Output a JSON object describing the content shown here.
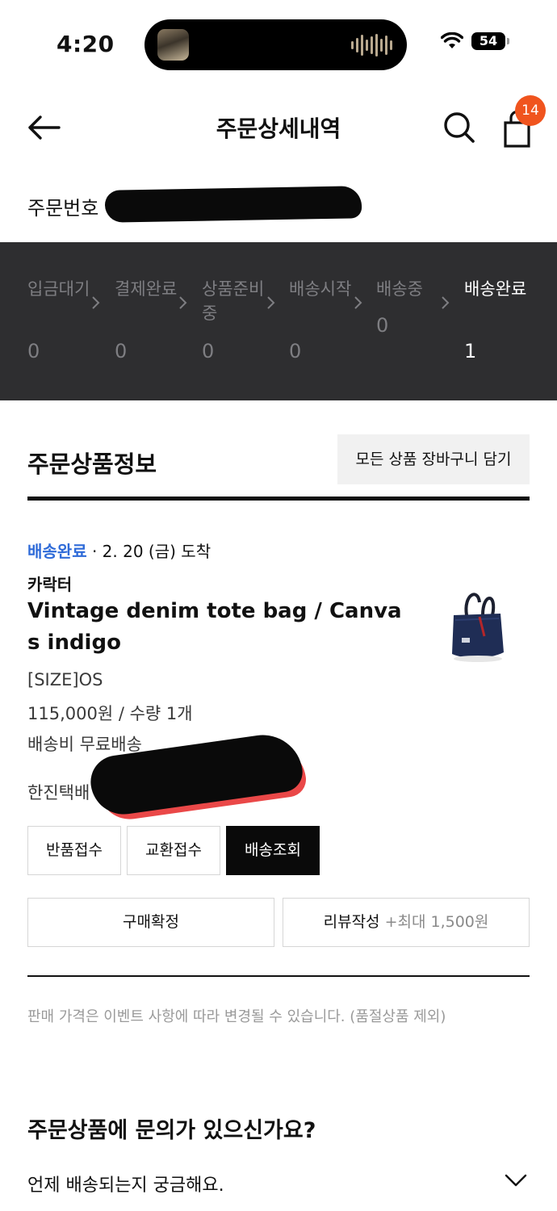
{
  "status_bar": {
    "time": "4:20",
    "battery": "54"
  },
  "header": {
    "title": "주문상세내역",
    "cart_badge": "14"
  },
  "order": {
    "number_label": "주문번호"
  },
  "progress": {
    "steps": [
      {
        "label": "입금대기",
        "count": "0"
      },
      {
        "label": "결제완료",
        "count": "0"
      },
      {
        "label": "상품준비중",
        "count": "0"
      },
      {
        "label": "배송시작",
        "count": "0"
      },
      {
        "label": "배송중",
        "count": "0"
      },
      {
        "label": "배송완료",
        "count": "1"
      }
    ],
    "active_index": 5
  },
  "section": {
    "title": "주문상품정보",
    "cart_all_label": "모든 상품 장바구니 담기"
  },
  "product": {
    "status": "배송완료",
    "arrival": " · 2. 20 (금) 도착",
    "brand": "카락터",
    "name": "Vintage denim tote bag / Canvas indigo",
    "option": "[SIZE]OS",
    "price_qty": "115,000원 / 수량 1개",
    "shipping_fee": "배송비 무료배송",
    "courier": "한진택배"
  },
  "actions": {
    "return_label": "반품접수",
    "exchange_label": "교환접수",
    "tracking_label": "배송조회",
    "confirm_label": "구매확정",
    "review_label": "리뷰작성",
    "review_reward": "+최대 1,500원"
  },
  "notice": "판매 가격은 이벤트 사항에 따라 변경될 수 있습니다. (품절상품 제외)",
  "faq": {
    "title": "주문상품에 문의가 있으신가요?",
    "item_1": "언제 배송되는지 궁금해요."
  },
  "colors": {
    "accent_blue": "#2f6bd8",
    "badge_orange": "#f0541e",
    "progress_bg": "#2e2e30"
  },
  "icons": [
    "back-arrow-icon",
    "search-icon",
    "shopping-bag-icon",
    "chevron-right-icon",
    "chevron-down-icon",
    "wifi-icon",
    "battery-icon"
  ]
}
